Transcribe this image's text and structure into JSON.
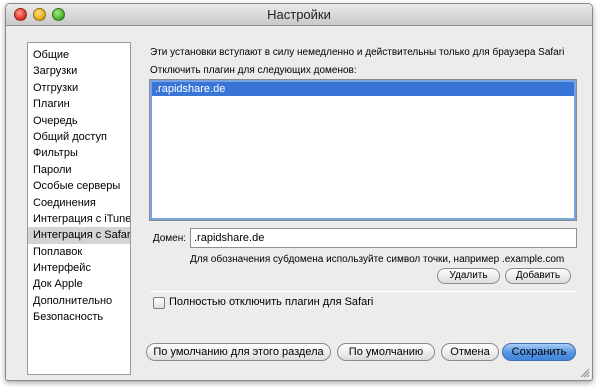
{
  "window": {
    "title": "Настройки"
  },
  "sidebar": {
    "items": [
      {
        "label": "Общие"
      },
      {
        "label": "Загрузки"
      },
      {
        "label": "Отгрузки"
      },
      {
        "label": "Плагин"
      },
      {
        "label": "Очередь"
      },
      {
        "label": "Общий доступ"
      },
      {
        "label": "Фильтры"
      },
      {
        "label": "Пароли"
      },
      {
        "label": "Особые серверы"
      },
      {
        "label": "Соединения"
      },
      {
        "label": "Интеграция с iTunes"
      },
      {
        "label": "Интеграция с Safari",
        "selected": true
      },
      {
        "label": "Поплавок"
      },
      {
        "label": "Интерфейс"
      },
      {
        "label": "Док Apple"
      },
      {
        "label": "Дополнительно"
      },
      {
        "label": "Безопасность"
      }
    ]
  },
  "main": {
    "note": "Эти установки вступают в силу немедленно и действительны только для браузера Safari",
    "domains_label": "Отключить плагин для следующих доменов:",
    "domains": [
      ".rapidshare.de"
    ],
    "selected_domain_index": 0,
    "domain_field_label": "Домен:",
    "domain_field_value": ".rapidshare.de",
    "hint": "Для обозначения субдомена используйте символ точки, например .example.com",
    "remove_button": "Удалить",
    "add_button": "Добавить",
    "disable_checkbox_label": "Полностью отключить плагин для Safari",
    "disable_checkbox_checked": false
  },
  "footer": {
    "section_defaults_button": "По умолчанию для этого раздела",
    "defaults_button": "По умолчанию",
    "cancel_button": "Отмена",
    "save_button": "Сохранить"
  }
}
